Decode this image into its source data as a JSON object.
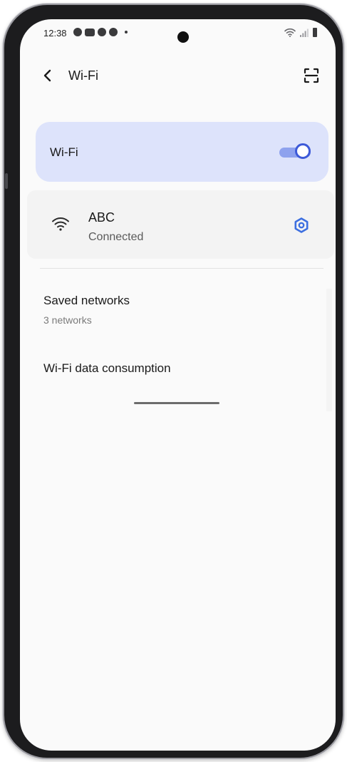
{
  "status_bar": {
    "time": "12:38"
  },
  "header": {
    "back_icon": "chevron-left-icon",
    "title": "Wi-Fi",
    "scan_icon": "qr-scan-icon"
  },
  "wifi_toggle": {
    "label": "Wi-Fi",
    "enabled": true,
    "accent_color": "#3d5ad8",
    "card_color": "#dde3fb"
  },
  "connected_network": {
    "icon": "wifi-signal-icon",
    "name": "ABC",
    "status": "Connected",
    "settings_icon": "gear-icon"
  },
  "list": {
    "saved_networks": {
      "title": "Saved networks",
      "subtitle": "3 networks"
    },
    "data_consumption": {
      "title": "Wi-Fi data consumption"
    }
  }
}
